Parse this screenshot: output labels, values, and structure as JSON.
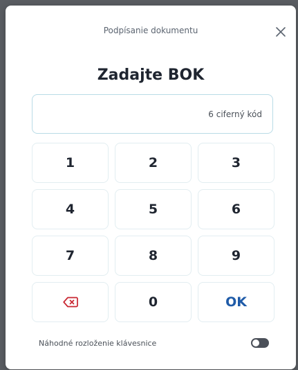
{
  "dialog": {
    "title": "Podpísanie dokumentu",
    "close_icon": "close-icon"
  },
  "heading": "Zadajte BOK",
  "code_input": {
    "value": "",
    "placeholder": "6 ciferný kód"
  },
  "keypad": {
    "keys": [
      "1",
      "2",
      "3",
      "4",
      "5",
      "6",
      "7",
      "8",
      "9"
    ],
    "backspace_icon": "backspace-icon",
    "zero": "0",
    "ok": "OK"
  },
  "footer": {
    "toggle_label": "Náhodné rozloženie klávesnice",
    "toggle_on": false
  },
  "colors": {
    "backdrop": "#5a5d62",
    "ok_text": "#1f5ba8",
    "backspace_icon": "#c8242f",
    "input_border": "#b9dbe6"
  }
}
